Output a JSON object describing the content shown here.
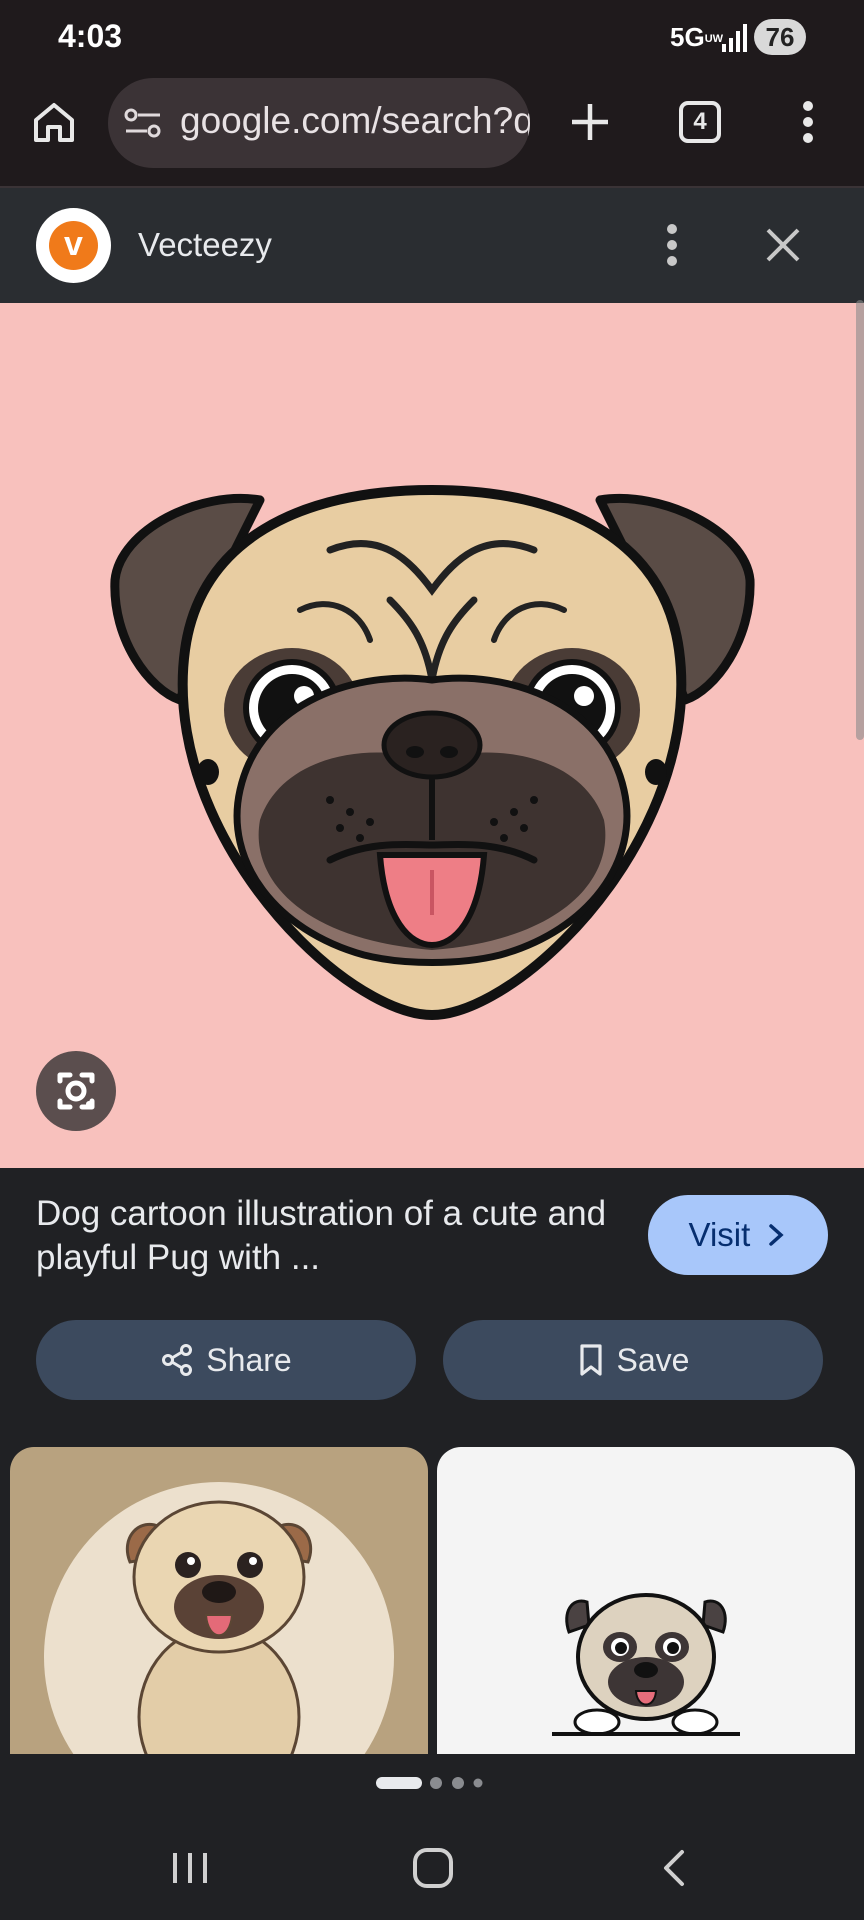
{
  "status": {
    "time": "4:03",
    "network": "5G",
    "network_sub": "UW",
    "battery": "76"
  },
  "browser": {
    "url": "google.com/search?q",
    "tab_count": "4"
  },
  "source": {
    "name": "Vecteezy",
    "logo_letter": "v"
  },
  "result": {
    "title": "Dog cartoon illustration of a cute and playful Pug with ...",
    "visit_label": "Visit"
  },
  "actions": {
    "share_label": "Share",
    "save_label": "Save"
  },
  "icons": [
    "home-icon",
    "tune-icon",
    "plus-icon",
    "tabs-icon",
    "more-vert-icon",
    "close-icon",
    "lens-icon",
    "chevron-right-icon",
    "share-icon",
    "bookmark-icon",
    "nav-recent-icon",
    "nav-home-icon",
    "nav-back-icon"
  ],
  "colors": {
    "accent": "#a8c7fa",
    "image_bg": "#f8c1bd",
    "button_bg": "#3c4a5e"
  }
}
